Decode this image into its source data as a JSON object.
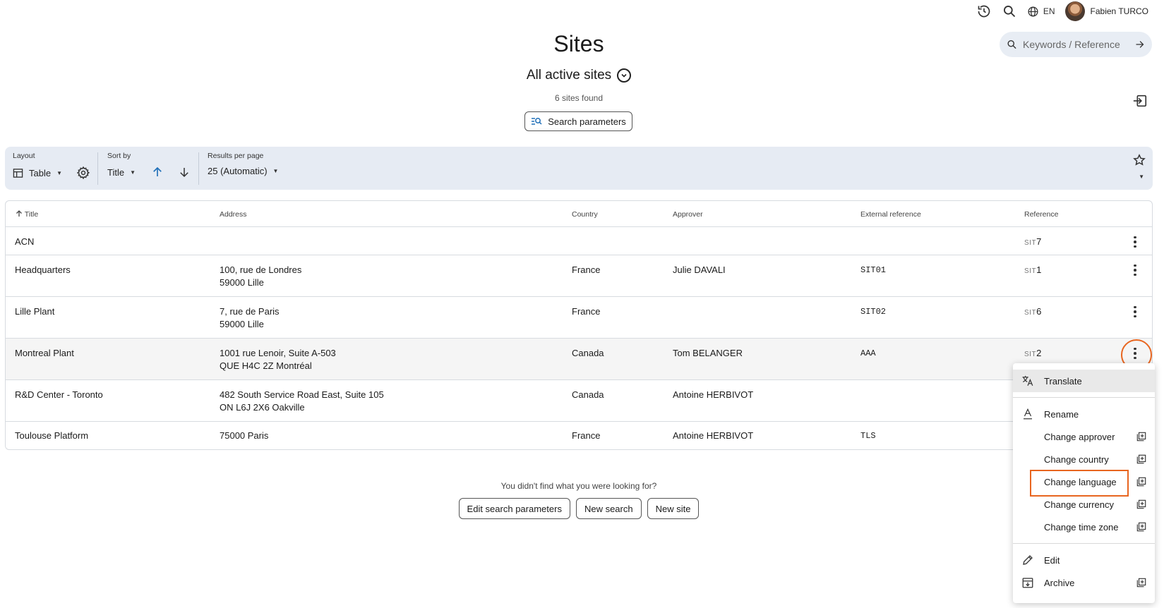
{
  "topbar": {
    "language": "EN",
    "user_name": "Fabien TURCO",
    "icons": [
      "history-icon",
      "search-icon",
      "globe-icon"
    ]
  },
  "header": {
    "title": "Sites",
    "view": "All active sites",
    "count": "6 sites found",
    "search_params_label": "Search parameters",
    "keyword_placeholder": "Keywords / Reference"
  },
  "toolbar": {
    "layout_label": "Layout",
    "layout_value": "Table",
    "sort_label": "Sort by",
    "sort_value": "Title",
    "results_label": "Results per page",
    "results_value": "25 (Automatic)"
  },
  "table": {
    "columns": [
      "Title",
      "Address",
      "Country",
      "Approver",
      "External reference",
      "Reference"
    ],
    "rows": [
      {
        "title": "ACN",
        "address1": "",
        "address2": "",
        "country": "",
        "approver": "",
        "ext_ref": "",
        "ref_prefix": "SIT",
        "ref_num": "7"
      },
      {
        "title": "Headquarters",
        "address1": "100, rue de Londres",
        "address2": "59000 Lille",
        "country": "France",
        "approver": "Julie DAVALI",
        "ext_ref": "SIT01",
        "ref_prefix": "SIT",
        "ref_num": "1"
      },
      {
        "title": "Lille Plant",
        "address1": "7, rue de Paris",
        "address2": "59000 Lille",
        "country": "France",
        "approver": "",
        "ext_ref": "SIT02",
        "ref_prefix": "SIT",
        "ref_num": "6"
      },
      {
        "title": "Montreal Plant",
        "address1": "1001 rue Lenoir, Suite A-503",
        "address2": "QUE H4C 2Z Montréal",
        "country": "Canada",
        "approver": "Tom BELANGER",
        "ext_ref": "AAA",
        "ref_prefix": "SIT",
        "ref_num": "2"
      },
      {
        "title": "R&D Center - Toronto",
        "address1": "482 South Service Road East, Suite 105",
        "address2": "ON L6J 2X6 Oakville",
        "country": "Canada",
        "approver": "Antoine HERBIVOT",
        "ext_ref": "",
        "ref_prefix": "",
        "ref_num": ""
      },
      {
        "title": "Toulouse Platform",
        "address1": "75000 Paris",
        "address2": "",
        "country": "France",
        "approver": "Antoine HERBIVOT",
        "ext_ref": "TLS",
        "ref_prefix": "",
        "ref_num": ""
      }
    ]
  },
  "footer": {
    "not_found": "You didn't find what you were looking for?",
    "edit_params": "Edit search parameters",
    "new_search": "New search",
    "new_site": "New site"
  },
  "menu": {
    "translate": "Translate",
    "rename": "Rename",
    "change_approver": "Change approver",
    "change_country": "Change country",
    "change_language": "Change language",
    "change_currency": "Change currency",
    "change_time_zone": "Change time zone",
    "edit": "Edit",
    "archive": "Archive"
  },
  "colors": {
    "accent": "#1f6fb8",
    "highlight": "#e8651f",
    "toolbar_bg": "#e6ebf3"
  }
}
